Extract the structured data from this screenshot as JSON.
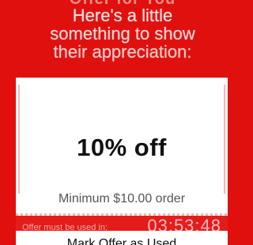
{
  "top_banner_text": "Offer for You",
  "headline": {
    "line1": "Here's a little",
    "line2": "something to show",
    "line3": "their appreciation:"
  },
  "coupon": {
    "discount": "10% off",
    "minimum": "Minimum $10.00 order"
  },
  "offer_timer": {
    "label": "Offer must be used in:",
    "time": "03:53:48"
  },
  "mark_used_label": "Mark Offer as Used",
  "colors": {
    "background": "#e0100f",
    "card": "#ffffff",
    "band": "#e41c1a"
  }
}
